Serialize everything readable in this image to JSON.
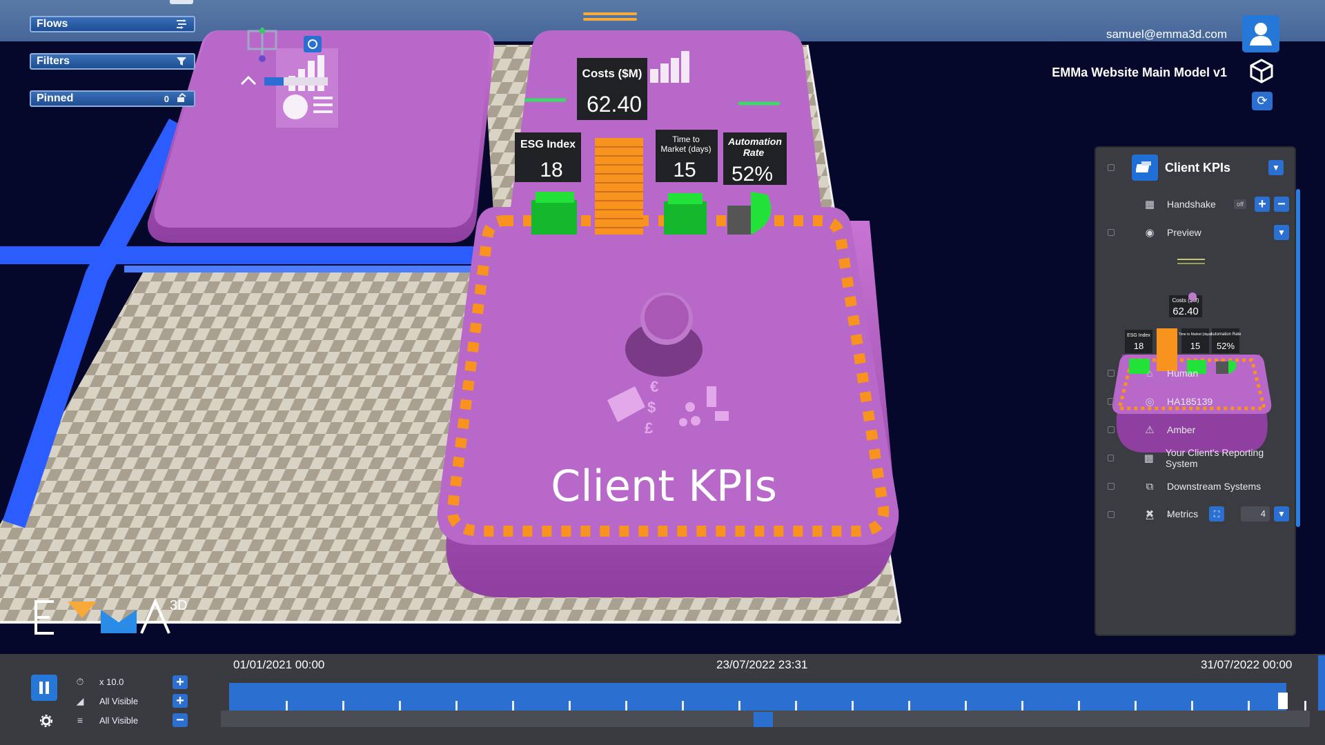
{
  "left_panels": {
    "flows": {
      "label": "Flows",
      "icon": "flows-icon"
    },
    "filters": {
      "label": "Filters",
      "icon": "filter-icon"
    },
    "pinned": {
      "label": "Pinned",
      "count": "0",
      "icon": "pin-stack-icon"
    }
  },
  "user": {
    "email": "samuel@emma3d.com"
  },
  "model": {
    "name": "EMMa Website Main Model v1"
  },
  "scene": {
    "main_platform_label": "Client KPIs",
    "kpis": [
      {
        "label": "Costs ($M)",
        "value": "62.40"
      },
      {
        "label": "ESG Index",
        "value": "18"
      },
      {
        "label": "Time to Market (days)",
        "value": "15"
      },
      {
        "label": "Automation Rate",
        "value": "52%"
      }
    ],
    "preview_costs_label": "Costs ($M)",
    "preview_ttm_label": "Time to Market (days)",
    "preview_auto_label": "Automation Rate",
    "colors": {
      "platform": "#b565c4",
      "stripe": "#f7931e",
      "kpi_bar": "#22e23a",
      "costs_bar": "#f7931e",
      "pipe": "#2a5cff"
    }
  },
  "right_panel": {
    "title": "Client KPIs",
    "handshake": {
      "label": "Handshake",
      "toggle": "off"
    },
    "preview": {
      "label": "Preview"
    },
    "items": [
      {
        "label": "Human",
        "icon": "human-icon"
      },
      {
        "label": "HA185139",
        "icon": "target-icon"
      },
      {
        "label": "Amber",
        "icon": "amber-icon"
      },
      {
        "label": "Your Client's Reporting System",
        "icon": "building-icon"
      },
      {
        "label": "Downstream Systems",
        "icon": "downstream-icon"
      },
      {
        "label": "-",
        "icon": "triangle-icon"
      }
    ],
    "metrics": {
      "label": "Metrics",
      "count": "4"
    }
  },
  "logo": {
    "text": "EMMA",
    "sup": "3D"
  },
  "timeline": {
    "speed": "x 10.0",
    "visible_1": "All Visible",
    "visible_2": "All Visible",
    "start": "01/01/2021 00:00",
    "current": "23/07/2022 23:31",
    "end": "31/07/2022 00:00"
  }
}
